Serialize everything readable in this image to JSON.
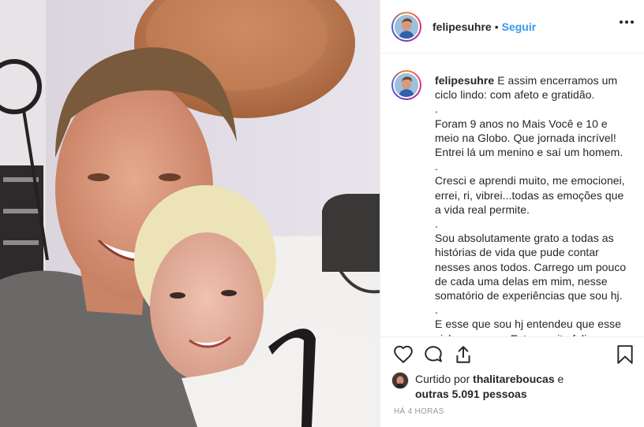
{
  "post": {
    "username": "felipesuhre",
    "separator": "•",
    "follow_label": "Seguir",
    "more_icon": "more-options-icon"
  },
  "caption": {
    "username": "felipesuhre",
    "text": " E assim encerramos um ciclo lindo: com afeto e gratidão.\n.\nForam 9 anos no Mais Você e 10 e meio na Globo. Que jornada incrível! Entrei lá um menino e saí um homem.\n.\nCresci e aprendi muito, me emocionei, errei, ri, vibrei...todas as emoções que a vida real permite.\n.\nSou absolutamente grato a todas as histórias de vida que pude contar nesses anos todos. Carrego um pouco de cada uma delas em mim, nesse somatório de experiências que sou hj.\n.\nE esse que sou hj entendeu que esse ciclo encerrou. Estou muito feliz."
  },
  "actions": {
    "like_icon": "heart-icon",
    "comment_icon": "comment-icon",
    "share_icon": "share-icon",
    "save_icon": "bookmark-icon"
  },
  "likes": {
    "prefix": "Curtido por ",
    "user": "thalitareboucas",
    "middle": " e",
    "others": "outras 5.091 pessoas"
  },
  "timestamp": "HÁ 4 HORAS",
  "colors": {
    "link_blue": "#3897f0",
    "text": "#262626",
    "muted": "#999999",
    "divider": "#efefef"
  }
}
